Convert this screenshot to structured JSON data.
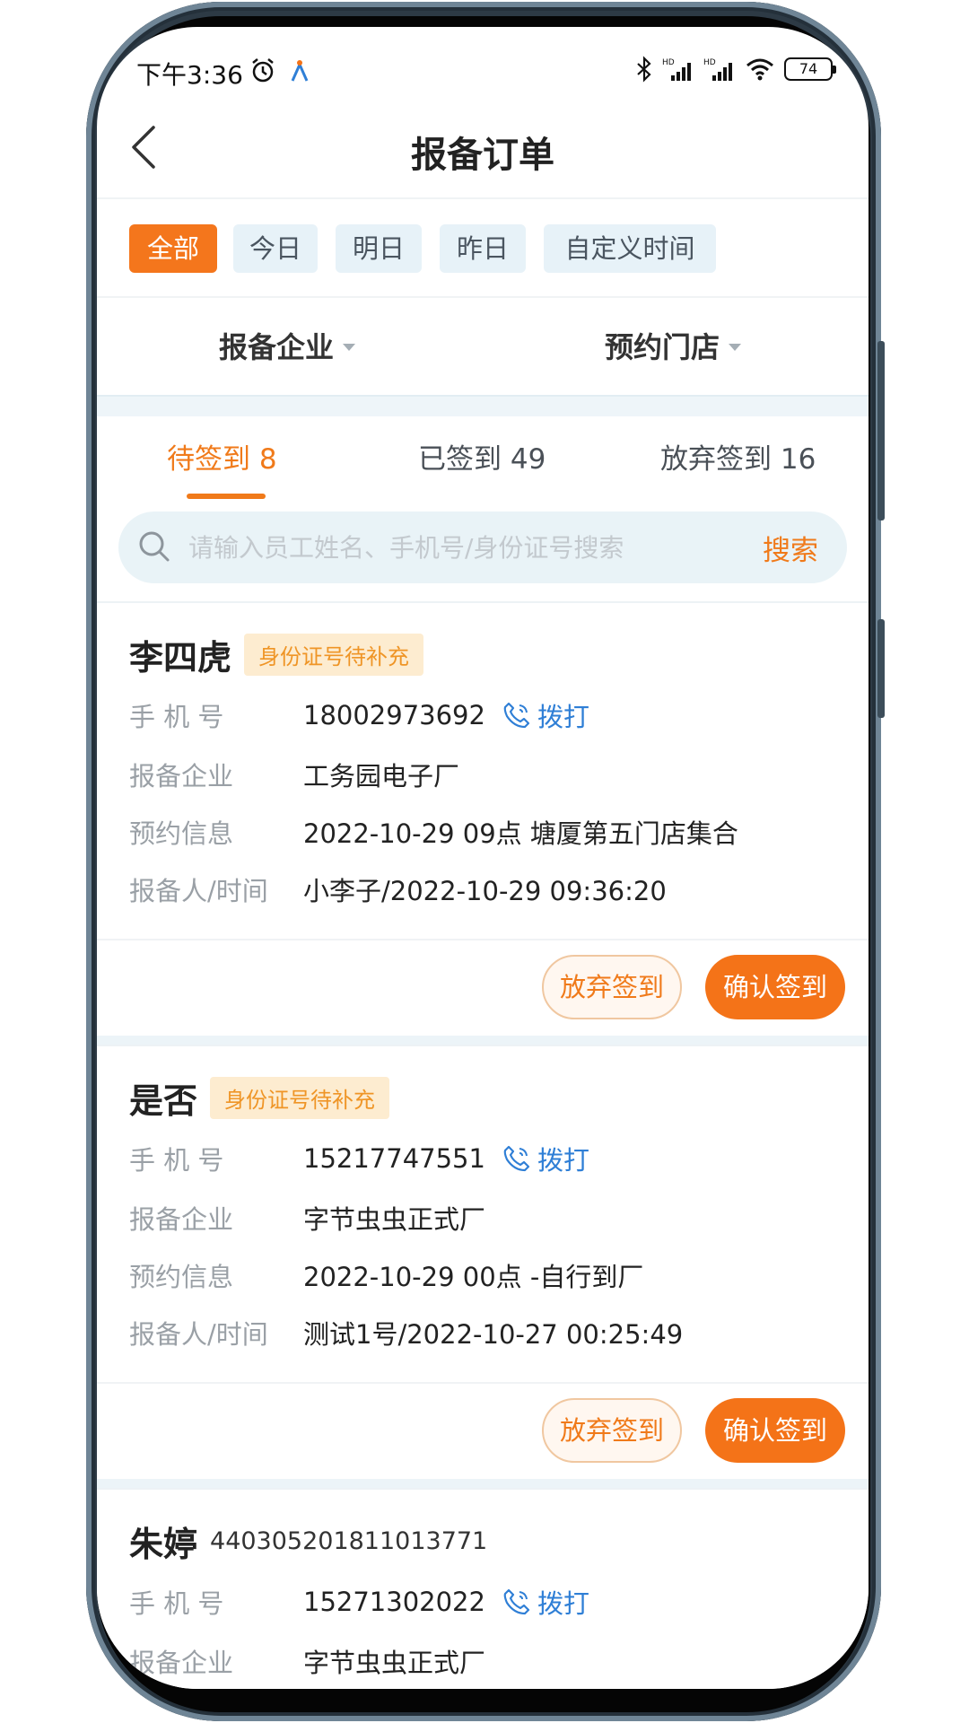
{
  "status_bar": {
    "time": "下午3:36",
    "battery": "74"
  },
  "header": {
    "title": "报备订单"
  },
  "date_filters": [
    "全部",
    "今日",
    "明日",
    "昨日",
    "自定义时间"
  ],
  "dropdowns": {
    "company": "报备企业",
    "store": "预约门店"
  },
  "tabs": [
    {
      "label": "待签到 8",
      "active": true
    },
    {
      "label": "已签到 49",
      "active": false
    },
    {
      "label": "放弃签到 16",
      "active": false
    }
  ],
  "search": {
    "placeholder": "请输入员工姓名、手机号/身份证号搜索",
    "button_label": "搜索"
  },
  "labels": {
    "phone": "手 机 号",
    "company": "报备企业",
    "appointment": "预约信息",
    "reporter": "报备人/时间",
    "call": "拨打",
    "abandon": "放弃签到",
    "confirm": "确认签到"
  },
  "records": [
    {
      "name": "李四虎",
      "badge": "身份证号待补充",
      "phone": "18002973692",
      "company": "工务园电子厂",
      "appointment": "2022-10-29 09点 塘厦第五门店集合",
      "reporter_time": "小李子/2022-10-29 09:36:20"
    },
    {
      "name": "是否",
      "badge": "身份证号待补充",
      "phone": "15217747551",
      "company": "字节虫虫正式厂",
      "appointment": "2022-10-29 00点 -自行到厂",
      "reporter_time": "测试1号/2022-10-27 00:25:49"
    },
    {
      "name": "朱婷",
      "id_number": "440305201811013771",
      "phone": "15271302022",
      "company": "字节虫虫正式厂"
    }
  ],
  "colors": {
    "accent": "#f47318",
    "link": "#2f7fd6",
    "chip_bg": "#e7f2f8",
    "badge_bg": "#fdecd0"
  }
}
